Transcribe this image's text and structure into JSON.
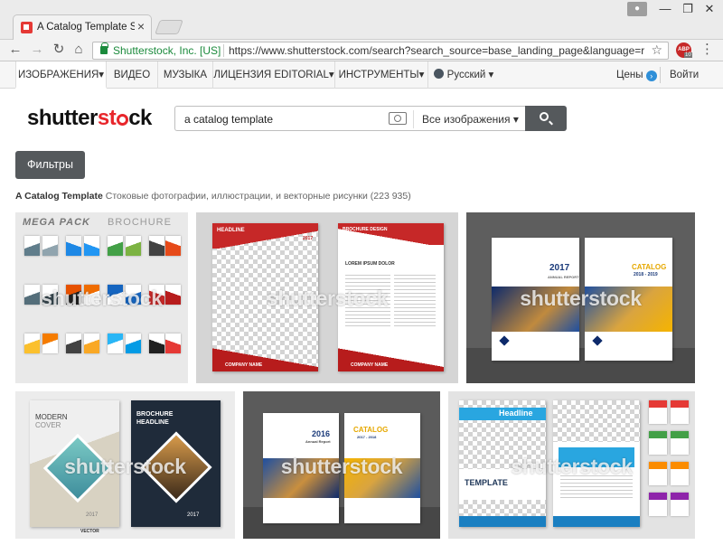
{
  "browser": {
    "tab_title": "A Catalog Template Sto",
    "tab_close": "×",
    "window_controls": [
      "—",
      "❐",
      "✕"
    ],
    "secure_label": "Shutterstock, Inc. [US]",
    "url": "https://www.shutterstock.com/search?search_source=base_landing_page&language=ru&se...",
    "abp_label": "ABP",
    "abp_count": "10"
  },
  "nav": {
    "items": [
      "ИЗОБРАЖЕНИЯ▾",
      "ВИДЕО",
      "МУЗЫКА",
      "ЛИЦЕНЗИЯ EDITORIAL▾",
      "ИНСТРУМЕНТЫ▾",
      "Русский ▾"
    ],
    "prices": "Цены",
    "login": "Войти"
  },
  "logo": {
    "main": "shutter",
    "accent": "st",
    "tail": "ck"
  },
  "search": {
    "query": "a catalog template",
    "type": "Все изображения ▾"
  },
  "filters_label": "Фильтры",
  "results": {
    "term": "A Catalog Template",
    "rest": " Стоковые фотографии, иллюстрации, и векторные рисунки (223 935)"
  },
  "watermark": "shutterstock",
  "tiles": {
    "t1": {
      "title1": "MEGA PACK",
      "title2": "BROCHURE"
    },
    "t2": {
      "headline": "HEADLINE",
      "year": "2017",
      "brochure": "BROCHURE DESIGN",
      "lorem": "LOREM IPSUM DOLOR",
      "company1": "COMPANY NAME",
      "company2": "COMPANY NAME"
    },
    "t3": {
      "year": "2017",
      "annual": "ANNUAL REPORT",
      "catalog": "CATALOG",
      "years": "2018 - 2019"
    },
    "t4": {
      "modern": "MODERN",
      "cover": "COVER",
      "brochure": "BROCHURE",
      "headline": "HEADLINE",
      "year1": "2017",
      "year2": "2017",
      "vector": "VECTOR"
    },
    "t5": {
      "year": "2016",
      "annual": "Annual Report",
      "catalog": "CATALOG",
      "years": "2017 - 2018"
    },
    "t6": {
      "headline": "Headline",
      "template": "TEMPLATE"
    }
  },
  "colors": {
    "accent_red": "#e8262b",
    "button_gray": "#55595c",
    "secure_green": "#1b8a3c"
  }
}
